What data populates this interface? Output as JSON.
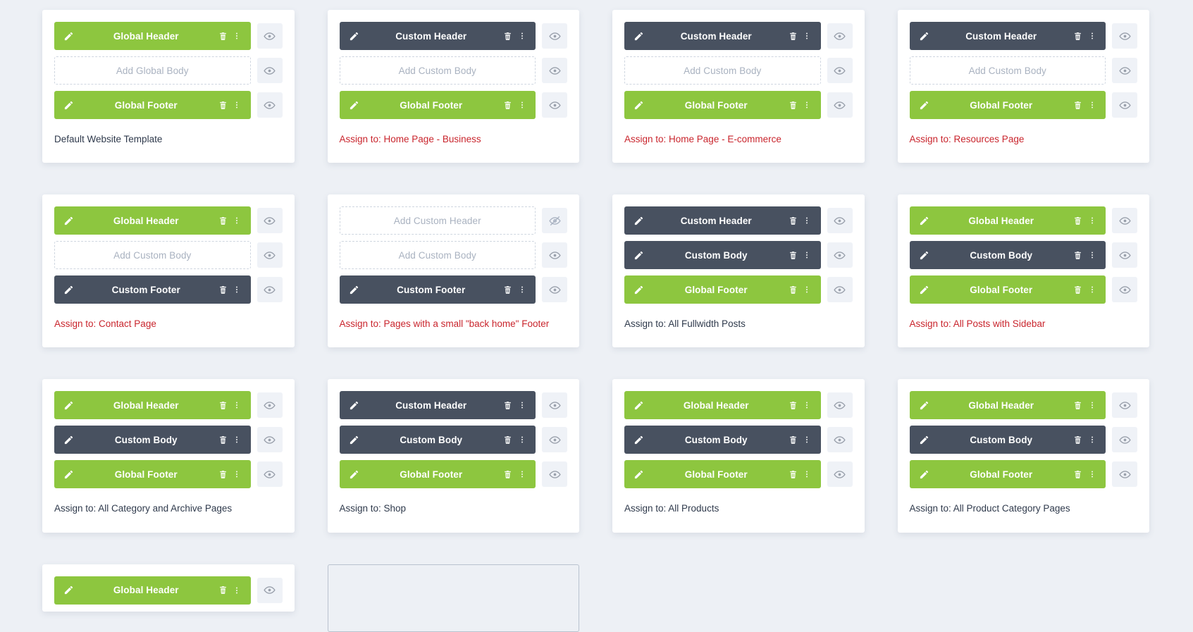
{
  "colors": {
    "page_background": "#edf0f5",
    "global_green": "#8dc63f",
    "custom_dark": "#485160",
    "assigned_red": "#c9252d",
    "neutral_text": "#2f3a4c",
    "placeholder_text": "#a9b2c0",
    "eye_button_bg": "#eff2f7"
  },
  "icons": {
    "edit": "pencil-icon",
    "delete": "trash-icon",
    "menu": "kebab-menu-icon",
    "visible": "eye-icon",
    "hidden": "eye-off-icon"
  },
  "cards": [
    {
      "id": "default-website-template",
      "caption": "Default Website Template",
      "caption_style": "neutral",
      "rows": [
        {
          "label": "Global Header",
          "style": "green",
          "empty": false,
          "visible": true
        },
        {
          "label": "Add Global Body",
          "style": "empty",
          "empty": true,
          "visible": true
        },
        {
          "label": "Global Footer",
          "style": "green",
          "empty": false,
          "visible": true
        }
      ]
    },
    {
      "id": "home-page-business",
      "caption": "Assign to: Home Page - Business",
      "caption_style": "assigned",
      "rows": [
        {
          "label": "Custom Header",
          "style": "dark",
          "empty": false,
          "visible": true
        },
        {
          "label": "Add Custom Body",
          "style": "empty",
          "empty": true,
          "visible": true
        },
        {
          "label": "Global Footer",
          "style": "green",
          "empty": false,
          "visible": true
        }
      ]
    },
    {
      "id": "home-page-ecommerce",
      "caption": "Assign to: Home Page - E-commerce",
      "caption_style": "assigned",
      "rows": [
        {
          "label": "Custom Header",
          "style": "dark",
          "empty": false,
          "visible": true
        },
        {
          "label": "Add Custom Body",
          "style": "empty",
          "empty": true,
          "visible": true
        },
        {
          "label": "Global Footer",
          "style": "green",
          "empty": false,
          "visible": true
        }
      ]
    },
    {
      "id": "resources-page",
      "caption": "Assign to: Resources Page",
      "caption_style": "assigned",
      "rows": [
        {
          "label": "Custom Header",
          "style": "dark",
          "empty": false,
          "visible": true
        },
        {
          "label": "Add Custom Body",
          "style": "empty",
          "empty": true,
          "visible": true
        },
        {
          "label": "Global Footer",
          "style": "green",
          "empty": false,
          "visible": true
        }
      ]
    },
    {
      "id": "contact-page",
      "caption": "Assign to: Contact Page",
      "caption_style": "assigned",
      "rows": [
        {
          "label": "Global Header",
          "style": "green",
          "empty": false,
          "visible": true
        },
        {
          "label": "Add Custom Body",
          "style": "empty",
          "empty": true,
          "visible": true
        },
        {
          "label": "Custom Footer",
          "style": "dark",
          "empty": false,
          "visible": true
        }
      ]
    },
    {
      "id": "pages-with-back-home-footer",
      "caption": "Assign to: Pages with a small \"back home\" Footer",
      "caption_style": "assigned",
      "rows": [
        {
          "label": "Add Custom Header",
          "style": "empty",
          "empty": true,
          "visible": false
        },
        {
          "label": "Add Custom Body",
          "style": "empty",
          "empty": true,
          "visible": true
        },
        {
          "label": "Custom Footer",
          "style": "dark",
          "empty": false,
          "visible": true
        }
      ]
    },
    {
      "id": "all-fullwidth-posts",
      "caption": "Assign to: All Fullwidth Posts",
      "caption_style": "neutral",
      "rows": [
        {
          "label": "Custom Header",
          "style": "dark",
          "empty": false,
          "visible": true
        },
        {
          "label": "Custom Body",
          "style": "dark",
          "empty": false,
          "visible": true
        },
        {
          "label": "Global Footer",
          "style": "green",
          "empty": false,
          "visible": true
        }
      ]
    },
    {
      "id": "all-posts-with-sidebar",
      "caption": "Assign to: All Posts with Sidebar",
      "caption_style": "assigned",
      "rows": [
        {
          "label": "Global Header",
          "style": "green",
          "empty": false,
          "visible": true
        },
        {
          "label": "Custom Body",
          "style": "dark",
          "empty": false,
          "visible": true
        },
        {
          "label": "Global Footer",
          "style": "green",
          "empty": false,
          "visible": true
        }
      ]
    },
    {
      "id": "all-category-and-archive-pages",
      "caption": "Assign to: All Category and Archive Pages",
      "caption_style": "neutral",
      "rows": [
        {
          "label": "Global Header",
          "style": "green",
          "empty": false,
          "visible": true
        },
        {
          "label": "Custom Body",
          "style": "dark",
          "empty": false,
          "visible": true
        },
        {
          "label": "Global Footer",
          "style": "green",
          "empty": false,
          "visible": true
        }
      ]
    },
    {
      "id": "shop",
      "caption": "Assign to: Shop",
      "caption_style": "neutral",
      "rows": [
        {
          "label": "Custom Header",
          "style": "dark",
          "empty": false,
          "visible": true
        },
        {
          "label": "Custom Body",
          "style": "dark",
          "empty": false,
          "visible": true
        },
        {
          "label": "Global Footer",
          "style": "green",
          "empty": false,
          "visible": true
        }
      ]
    },
    {
      "id": "all-products",
      "caption": "Assign to: All Products",
      "caption_style": "neutral",
      "rows": [
        {
          "label": "Global Header",
          "style": "green",
          "empty": false,
          "visible": true
        },
        {
          "label": "Custom Body",
          "style": "dark",
          "empty": false,
          "visible": true
        },
        {
          "label": "Global Footer",
          "style": "green",
          "empty": false,
          "visible": true
        }
      ]
    },
    {
      "id": "all-product-category-pages",
      "caption": "Assign to: All Product Category Pages",
      "caption_style": "neutral",
      "rows": [
        {
          "label": "Global Header",
          "style": "green",
          "empty": false,
          "visible": true
        },
        {
          "label": "Custom Body",
          "style": "dark",
          "empty": false,
          "visible": true
        },
        {
          "label": "Global Footer",
          "style": "green",
          "empty": false,
          "visible": true
        }
      ]
    },
    {
      "id": "partial-bottom-template",
      "caption": "",
      "caption_style": "neutral",
      "rows": [
        {
          "label": "Global Header",
          "style": "green",
          "empty": false,
          "visible": true
        }
      ]
    },
    {
      "id": "empty-drop-placeholder",
      "caption": "",
      "caption_style": "neutral",
      "placeholder": true,
      "rows": []
    }
  ]
}
